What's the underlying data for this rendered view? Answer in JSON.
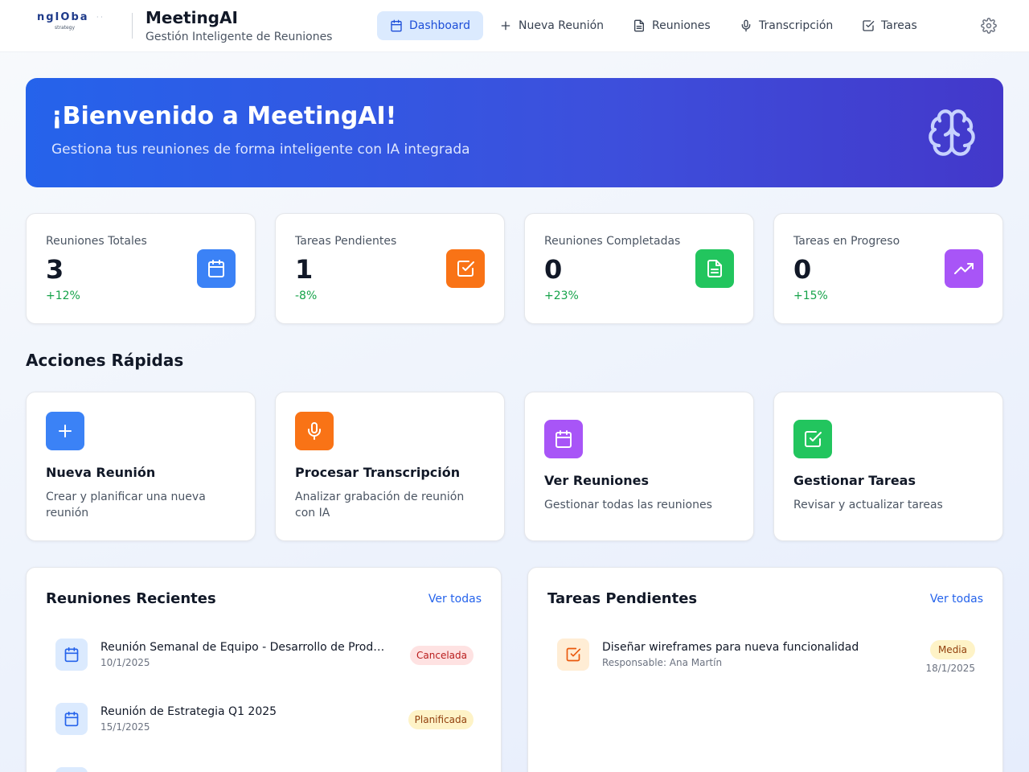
{
  "header": {
    "logo_text": "ngIOba",
    "logo_sub": "strategy",
    "title": "MeetingAI",
    "subtitle": "Gestión Inteligente de Reuniones",
    "nav": [
      {
        "label": "Dashboard",
        "icon": "calendar-icon",
        "active": true
      },
      {
        "label": "Nueva Reunión",
        "icon": "plus-icon",
        "active": false
      },
      {
        "label": "Reuniones",
        "icon": "document-icon",
        "active": false
      },
      {
        "label": "Transcripción",
        "icon": "microphone-icon",
        "active": false
      },
      {
        "label": "Tareas",
        "icon": "check-square-icon",
        "active": false
      }
    ],
    "settings_icon": "gear-icon"
  },
  "hero": {
    "title": "¡Bienvenido a MeetingAI!",
    "subtitle": "Gestiona tus reuniones de forma inteligente con IA integrada",
    "icon": "brain-icon"
  },
  "stats": [
    {
      "label": "Reuniones Totales",
      "value": "3",
      "change": "+12%",
      "icon": "calendar-icon",
      "color": "#3b82f6"
    },
    {
      "label": "Tareas Pendientes",
      "value": "1",
      "change": "-8%",
      "icon": "check-square-icon",
      "color": "#f97316"
    },
    {
      "label": "Reuniones Completadas",
      "value": "0",
      "change": "+23%",
      "icon": "document-icon",
      "color": "#22c55e"
    },
    {
      "label": "Tareas en Progreso",
      "value": "0",
      "change": "+15%",
      "icon": "trending-up-icon",
      "color": "#a855f7"
    }
  ],
  "quick_actions": {
    "title": "Acciones Rápidas",
    "items": [
      {
        "title": "Nueva Reunión",
        "desc": "Crear y planificar una nueva reunión",
        "icon": "plus-icon",
        "color": "#3b82f6"
      },
      {
        "title": "Procesar Transcripción",
        "desc": "Analizar grabación de reunión con IA",
        "icon": "microphone-icon",
        "color": "#f97316"
      },
      {
        "title": "Ver Reuniones",
        "desc": "Gestionar todas las reuniones",
        "icon": "calendar-icon",
        "color": "#a855f7"
      },
      {
        "title": "Gestionar Tareas",
        "desc": "Revisar y actualizar tareas",
        "icon": "check-square-icon",
        "color": "#22c55e"
      }
    ]
  },
  "recent_meetings": {
    "title": "Reuniones Recientes",
    "link": "Ver todas",
    "items": [
      {
        "title": "Reunión Semanal de Equipo - Desarrollo de Producto",
        "date": "10/1/2025",
        "status": "Cancelada",
        "status_color": "#b91c1c"
      },
      {
        "title": "Reunión de Estrategia Q1 2025",
        "date": "15/1/2025",
        "status": "Planificada",
        "status_color": "#92400e"
      }
    ]
  },
  "pending_tasks": {
    "title": "Tareas Pendientes",
    "link": "Ver todas",
    "items": [
      {
        "title": "Diseñar wireframes para nueva funcionalidad",
        "owner": "Responsable: Ana Martín",
        "priority": "Media",
        "date": "18/1/2025",
        "icon": "check-square-icon"
      }
    ]
  }
}
